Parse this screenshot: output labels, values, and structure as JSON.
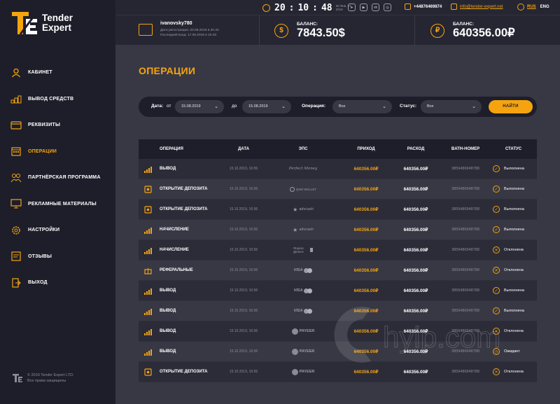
{
  "brand": {
    "line1": "Tender",
    "line2": "Expert",
    "copyright1": "© 2019 Tender Expert LTD.",
    "copyright2": "Все права защищены",
    "accent": "#f5a40f"
  },
  "topbar": {
    "time": {
      "h": "20",
      "m": "10",
      "s": "48",
      "date": "30 Янв, Чт 2019"
    },
    "socials": [
      "telegram-icon",
      "youtube-icon",
      "vk-icon",
      "instagram-icon"
    ],
    "phone": "+44876469874",
    "email": "info@tender-expert.net",
    "lang_active": "RUS",
    "lang_other": "ENG"
  },
  "header": {
    "username": "ivanovsky780",
    "registered": "Дата регистрации: 20.08.2019 в 20.40",
    "last_login": "Последний вход: 17.09.2019 в 20.40",
    "balance_label": "БАЛАНС:",
    "balance_usd": "7843.50$",
    "balance_rub": "640356.00₽"
  },
  "nav": [
    {
      "label": "КАБИНЕТ",
      "icon": "user-icon"
    },
    {
      "label": "ВЫВОД СРЕДСТВ",
      "icon": "coins-icon"
    },
    {
      "label": "РЕКВИЗИТЫ",
      "icon": "card-icon"
    },
    {
      "label": "ОПЕРАЦИИ",
      "icon": "calendar-icon",
      "active": true
    },
    {
      "label": "ПАРТНЁРСКАЯ ПРОГРАММА",
      "icon": "partners-icon"
    },
    {
      "label": "РЕКЛАМНЫЕ МАТЕРИАЛЫ",
      "icon": "monitor-icon"
    },
    {
      "label": "НАСТРОЙКИ",
      "icon": "gear-icon"
    },
    {
      "label": "ОТЗЫВЫ",
      "icon": "reviews-icon"
    },
    {
      "label": "ВЫХОД",
      "icon": "exit-icon"
    }
  ],
  "page_title": "ОПЕРАЦИИ",
  "filters": {
    "date_label": "Дата:",
    "from_label": "от",
    "from_value": "15.08.2019",
    "to_label": "до",
    "to_value": "15.08.2019",
    "operation_label": "Операция:",
    "operation_value": "Все",
    "status_label": "Статус:",
    "status_value": "Все",
    "find_button": "НАЙТИ"
  },
  "table": {
    "headers": [
      "ОПЕРАЦИЯ",
      "ДАТА",
      "ЭПС",
      "ПРИХОД",
      "РАСХОД",
      "BATH-НОМЕР",
      "СТАТУС"
    ],
    "rows": [
      {
        "op": "ВЫВОД",
        "icon": "bars-icon",
        "date": "15.10.2019, 16:56",
        "eps": "Perfect Money",
        "in": "640356.00₽",
        "out": "640356.00₽",
        "batch": "3859486948788",
        "status": "Выполнена",
        "status_icon": "check-icon"
      },
      {
        "op": "ОТКРЫТИЕ ДЕПОЗИТА",
        "icon": "deposit-icon",
        "date": "15.10.2019, 16:56",
        "eps": "QIWI WALLET",
        "in": "640356.00₽",
        "out": "640356.00₽",
        "batch": "3859486948788",
        "status": "Выполнена",
        "status_icon": "check-icon"
      },
      {
        "op": "ОТКРЫТИЕ ДЕПОЗИТА",
        "icon": "deposit-icon",
        "date": "15.10.2019, 16:56",
        "eps": "advcash",
        "in": "640356.00₽",
        "out": "640356.00₽",
        "batch": "3859486948788",
        "status": "Выполнена",
        "status_icon": "check-icon"
      },
      {
        "op": "НАЧИСЛЕНИЕ",
        "icon": "bars-icon",
        "date": "15.10.2019, 16:56",
        "eps": "advcash",
        "in": "640356.00₽",
        "out": "640356.00₽",
        "batch": "3859486948788",
        "status": "Выполнена",
        "status_icon": "check-icon"
      },
      {
        "op": "НАЧИСЛЕНИЕ",
        "icon": "bars-icon",
        "date": "15.10.2019, 16:56",
        "eps": "Яндекс Деньги",
        "in": "640356.00₽",
        "out": "640356.00₽",
        "batch": "3859486948788",
        "status": "Отклонена",
        "status_icon": "cross-icon"
      },
      {
        "op": "РЕФЕРАЛЬНЫЕ",
        "icon": "gift-icon",
        "date": "15.10.2019, 16:56",
        "eps": "VISA",
        "in": "640356.00₽",
        "out": "640356.00₽",
        "batch": "3859486948788",
        "status": "Отклонена",
        "status_icon": "cross-icon"
      },
      {
        "op": "ВЫВОД",
        "icon": "bars-icon",
        "date": "15.10.2019, 16:56",
        "eps": "VISA",
        "in": "640356.00₽",
        "out": "640356.00₽",
        "batch": "3859486948788",
        "status": "Выполнена",
        "status_icon": "check-icon"
      },
      {
        "op": "ВЫВОД",
        "icon": "bars-icon",
        "date": "15.10.2019, 16:56",
        "eps": "VISA",
        "in": "640356.00₽",
        "out": "640356.00₽",
        "batch": "3859486948788",
        "status": "Выполнена",
        "status_icon": "check-icon"
      },
      {
        "op": "ВЫВОД",
        "icon": "bars-icon",
        "date": "15.10.2019, 16:56",
        "eps": "PAYEER",
        "in": "640356.00₽",
        "out": "640356.00₽",
        "batch": "3859486948788",
        "status": "Отклонена",
        "status_icon": "cross-icon"
      },
      {
        "op": "ВЫВОД",
        "icon": "bars-icon",
        "date": "15.10.2019, 16:56",
        "eps": "PAYEER",
        "in": "640356.00₽",
        "out": "640356.00₽",
        "batch": "3859486948788",
        "status": "Ожидает",
        "status_icon": "clock-icon"
      },
      {
        "op": "ОТКРЫТИЕ ДЕПОЗИТА",
        "icon": "deposit-icon",
        "date": "15.10.2019, 16:56",
        "eps": "PAYEER",
        "in": "640356.00₽",
        "out": "640356.00₽",
        "batch": "3859486948788",
        "status": "Отклонена",
        "status_icon": "cross-icon"
      }
    ]
  },
  "watermark": "hyip.com"
}
